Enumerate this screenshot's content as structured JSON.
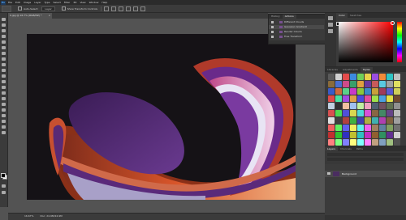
{
  "menu": [
    "File",
    "Edit",
    "Image",
    "Layer",
    "Type",
    "Select",
    "Filter",
    "3D",
    "View",
    "Window",
    "Help"
  ],
  "app_logo": "Ps",
  "options": {
    "auto_select_label": "Auto-Select:",
    "auto_select_value": "Layer",
    "transform_label": "Show Transform Controls"
  },
  "document": {
    "tab_title": "0.jpg @ 16.7% (RGB/8#) *",
    "close_glyph": "×"
  },
  "status": {
    "zoom": "16.67%",
    "info": "Doc: 24.9M/24.9M"
  },
  "history_panel": {
    "tabs": [
      "History",
      "Actions"
    ],
    "steps": [
      "Different Clouds",
      "Gaussian Gradient",
      "Render Clouds",
      "Free Transform"
    ]
  },
  "color_panel": {
    "tabs": [
      "Color",
      "Swatches"
    ]
  },
  "styles_panel": {
    "tabs": [
      "Libraries",
      "Adjustments",
      "Styles"
    ],
    "swatch_colors": [
      "#5a5a5a",
      "#d0d0d0",
      "#e34b4b",
      "#3c8ae0",
      "#6fcf5a",
      "#e8d14a",
      "#9a4de0",
      "#f08a3a",
      "#2ec4c4",
      "#c0c0c0",
      "#8a6b3a",
      "#4a6fd0",
      "#d04a8a",
      "#3aa06a",
      "#e0a040",
      "#6a3aa0",
      "#c85a5a",
      "#5ac8e0",
      "#a0a0a0",
      "#e0e060",
      "#3a5ac8",
      "#d06a3a",
      "#5ad08a",
      "#c83ac8",
      "#8ac83a",
      "#3a8ac8",
      "#c8a03a",
      "#a03a5a",
      "#5a5ad0",
      "#d0d05a",
      "#e04a4a",
      "#4ae0a0",
      "#a04ae0",
      "#e0a04a",
      "#4a4ae0",
      "#e04aa0",
      "#a0e04a",
      "#4aa0e0",
      "#e0e04a",
      "#704a30",
      "#c0d0e0",
      "#303030",
      "#f0c0a0",
      "#a0c0f0",
      "#c0f0a0",
      "#f0a0c0",
      "#506070",
      "#705060",
      "#607050",
      "#909090",
      "#d85050",
      "#50d850",
      "#5050d8",
      "#d8d850",
      "#50d8d8",
      "#d850d8",
      "#886644",
      "#448866",
      "#664488",
      "#bbbbbb",
      "#e0e0e0",
      "#404040",
      "#b04040",
      "#40b040",
      "#4040b0",
      "#b0b040",
      "#40b0b0",
      "#b040b0",
      "#806040",
      "#a0a0a0",
      "#f06060",
      "#60f060",
      "#6060f0",
      "#f0f060",
      "#60f0f0",
      "#f060f0",
      "#a08060",
      "#6080a0",
      "#80a060",
      "#707070",
      "#c03030",
      "#30c030",
      "#3030c0",
      "#c0c030",
      "#30c0c0",
      "#c030c0",
      "#906030",
      "#309060",
      "#603090",
      "#d0d0d0",
      "#ff8080",
      "#80ff80",
      "#8080ff",
      "#ffff80",
      "#80ffff",
      "#ff80ff",
      "#c0a080",
      "#80a0c0",
      "#a0c080",
      "#505050"
    ]
  },
  "layers_panel": {
    "tabs": [
      "Layers",
      "Channels",
      "Paths"
    ],
    "layer_name": "Background"
  }
}
